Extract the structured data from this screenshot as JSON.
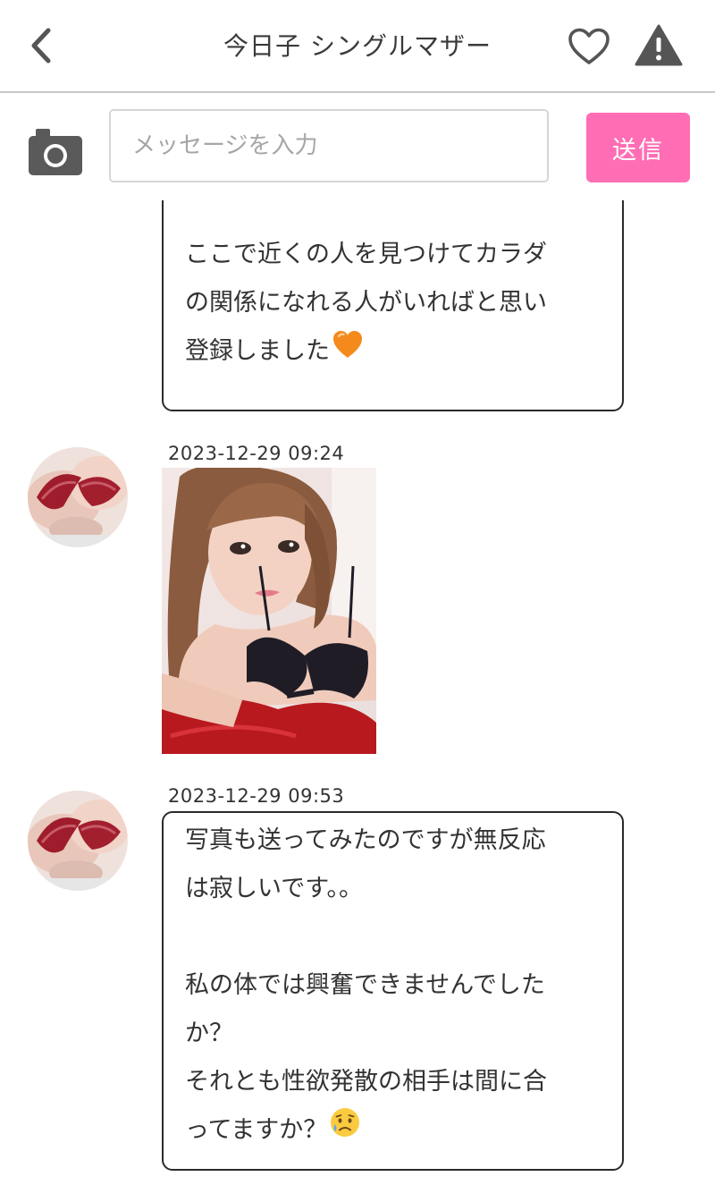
{
  "header": {
    "title": "今日子 シングルマザー",
    "back_icon": "chevron-left-icon",
    "favorite_icon": "heart-outline-icon",
    "report_icon": "warning-triangle-icon"
  },
  "composer": {
    "camera_icon": "camera-icon",
    "input_placeholder": "メッセージを入力",
    "input_value": "",
    "send_label": "送信",
    "send_color": "#ff6eb4"
  },
  "messages": [
    {
      "type": "text",
      "text": "ここで近くの人を見つけてカラダの関係になれる人がいればと思い登録しました",
      "emoji": "orange-heart-icon"
    },
    {
      "type": "image",
      "timestamp": "2023-12-29 09:24",
      "image_icon": "photo-thumbnail"
    },
    {
      "type": "text",
      "timestamp": "2023-12-29 09:53",
      "lines": [
        "写真も送ってみたのですが無反応",
        "は寂しいです。。",
        "",
        "私の体では興奮できませんでした",
        "か？",
        "それとも性欲発散の相手は間に合",
        "ってますか？"
      ],
      "emoji": "sad-sweat-face-icon"
    }
  ],
  "top_bubble_lines": [
    "ここで近くの人を見つけてカラダ",
    "の関係になれる人がいればと思い",
    "登録しました"
  ]
}
